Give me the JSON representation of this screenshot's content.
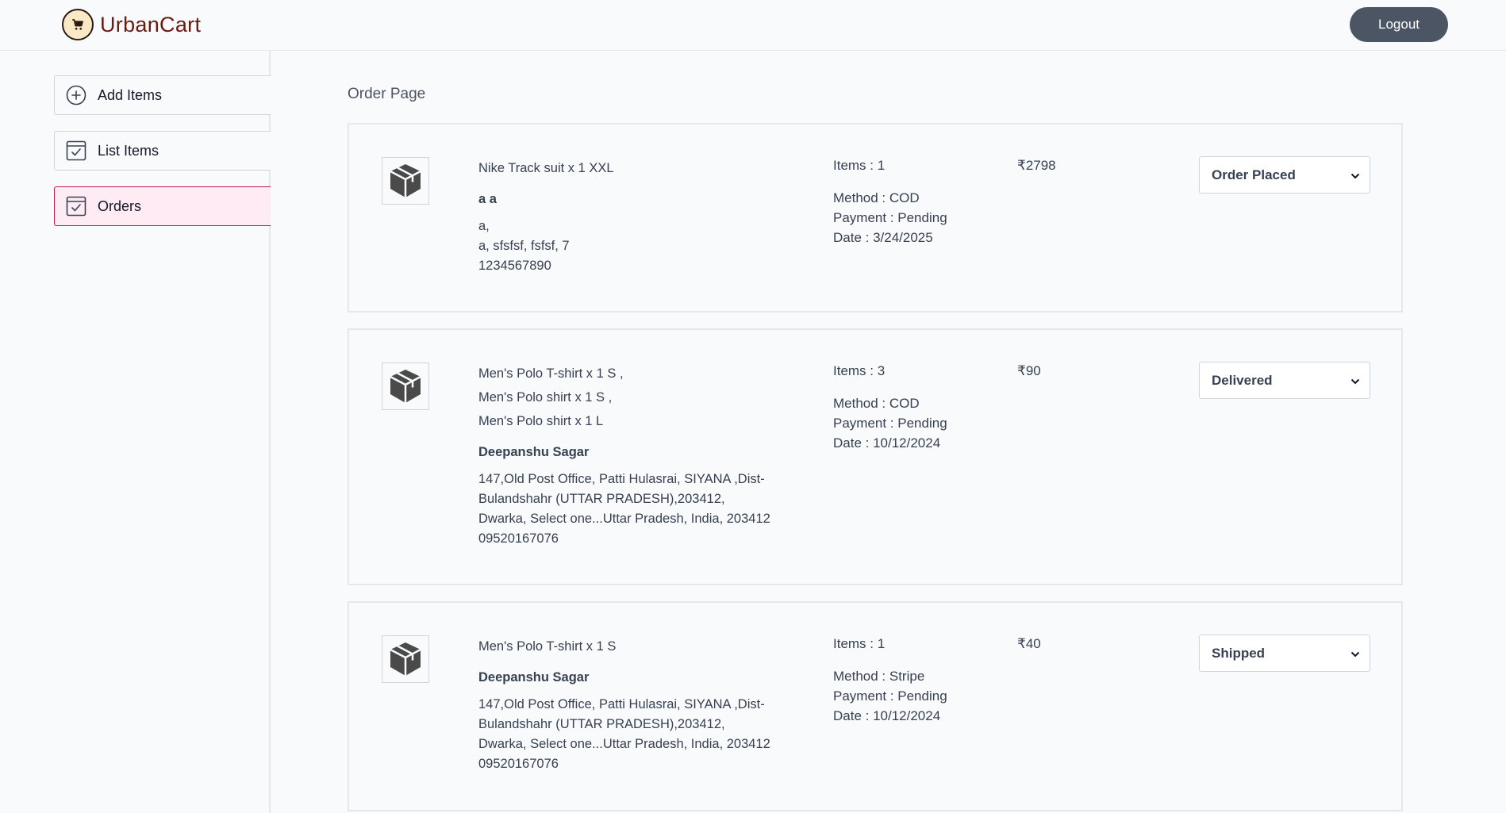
{
  "header": {
    "brand": "UrbanCart",
    "logout_label": "Logout"
  },
  "sidebar": {
    "items": [
      {
        "label": "Add Items",
        "icon": "plus-circle-icon"
      },
      {
        "label": "List Items",
        "icon": "checkbox-icon"
      },
      {
        "label": "Orders",
        "icon": "checkbox-icon",
        "active": true
      }
    ]
  },
  "main": {
    "title": "Order Page",
    "orders": [
      {
        "items": [
          "Nike Track suit x 1 XXL"
        ],
        "name": "a a",
        "address": [
          "a,",
          "a, sfsfsf, fsfsf, 7"
        ],
        "phone": "1234567890",
        "count": "Items : 1",
        "method": "Method : COD",
        "payment": "Payment : Pending",
        "date": "Date : 3/24/2025",
        "amount": "₹2798",
        "status": "Order Placed"
      },
      {
        "items": [
          "Men's Polo T-shirt x 1 S ,",
          "Men's Polo shirt x 1 S ,",
          "Men's Polo shirt x 1 L"
        ],
        "name": "Deepanshu Sagar",
        "address": [
          "147,Old Post Office, Patti Hulasrai, SIYANA ,Dist-",
          "Bulandshahr (UTTAR PRADESH),203412,",
          "Dwarka, Select one...Uttar Pradesh, India, 203412"
        ],
        "phone": "09520167076",
        "count": "Items : 3",
        "method": "Method : COD",
        "payment": "Payment : Pending",
        "date": "Date : 10/12/2024",
        "amount": "₹90",
        "status": "Delivered"
      },
      {
        "items": [
          "Men's Polo T-shirt x 1 S"
        ],
        "name": "Deepanshu Sagar",
        "address": [
          "147,Old Post Office, Patti Hulasrai, SIYANA ,Dist-",
          "Bulandshahr (UTTAR PRADESH),203412,",
          "Dwarka, Select one...Uttar Pradesh, India, 203412"
        ],
        "phone": "09520167076",
        "count": "Items : 1",
        "method": "Method : Stripe",
        "payment": "Payment : Pending",
        "date": "Date : 10/12/2024",
        "amount": "₹40",
        "status": "Shipped"
      }
    ]
  }
}
